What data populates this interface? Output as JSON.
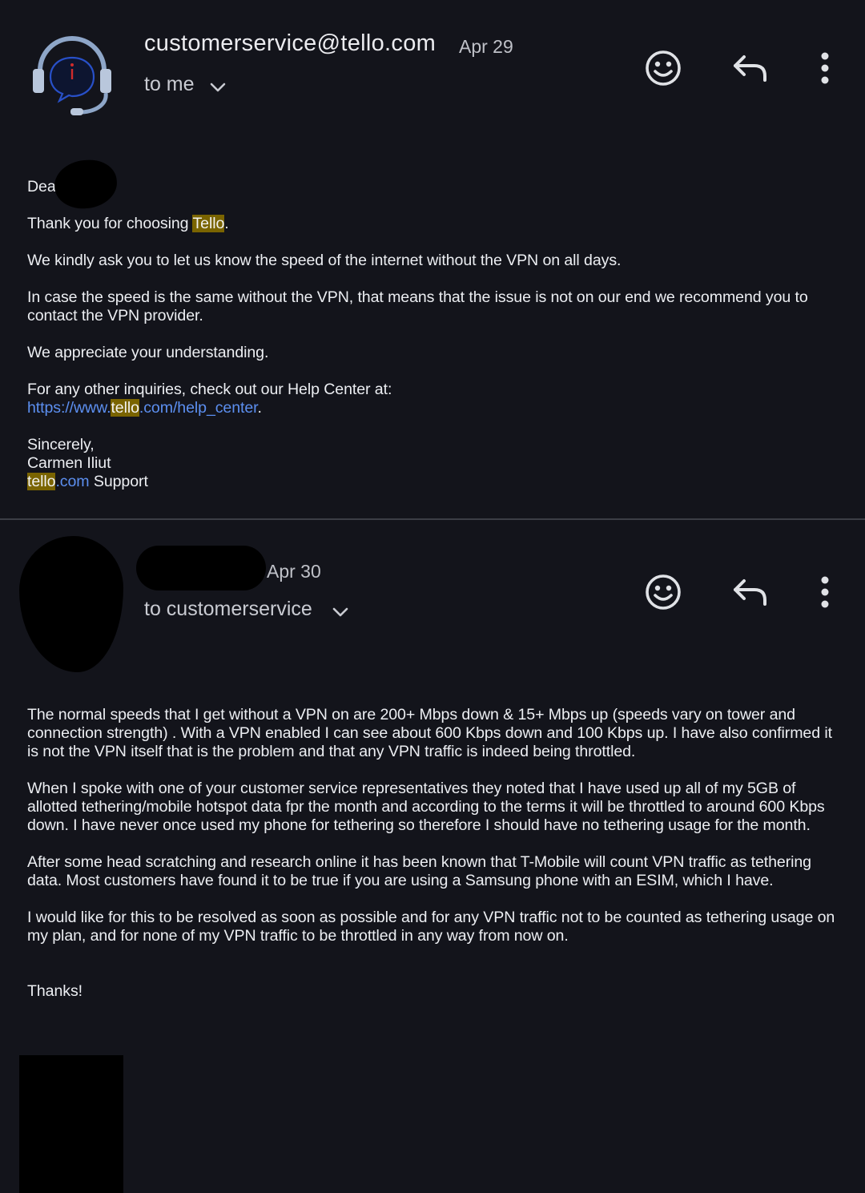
{
  "messages": [
    {
      "sender": "customerservice@tello.com",
      "date": "Apr 29",
      "recipient": "to me",
      "body": {
        "greeting": "Dear",
        "thanks_prefix": "Thank you for choosing ",
        "thanks_brand": "Tello",
        "thanks_suffix": ".",
        "p2": "We kindly ask you to let us know the speed of the internet without the VPN on all days.",
        "p3": "In case the speed is the same without the VPN, that means that the issue is not on our end we recommend you to contact the VPN provider.",
        "p4": "We appreciate your understanding.",
        "help_text": "For any other inquiries, check out our Help Center at:",
        "link_prefix": "https://www.",
        "link_brand": "tello",
        "link_suffix": ".com/help_center",
        "link_after": ".",
        "signoff": "Sincerely,",
        "signer": "Carmen Iliut",
        "sig_brand": "tello",
        "sig_domain": ".com",
        "sig_rest": " Support"
      }
    },
    {
      "date": "Apr 30",
      "recipient": "to customerservice",
      "body": {
        "p1": "The normal speeds that I get without a VPN on are 200+ Mbps down & 15+ Mbps up (speeds vary on tower and connection strength) . With a VPN enabled I can see about 600 Kbps down and 100 Kbps up. I have also confirmed it is not the VPN itself that is the problem and that any VPN traffic is indeed being throttled.",
        "p2": "When I spoke with one of your customer service representatives they noted that I have used up all of my 5GB of allotted tethering/mobile hotspot data fpr the month and according to the terms it will be throttled to around 600 Kbps down. I have never once used my phone for tethering so therefore I should have no tethering usage for the month.",
        "p3": "After some head scratching and research online it has been known that T-Mobile will count VPN traffic as tethering data. Most customers have found it to be true if you are using a Samsung phone with an ESIM, which I have.",
        "p4": "I would like for this to be resolved as soon as possible and for any VPN traffic not to be counted as tethering usage on my plan, and for none of my VPN traffic to be throttled in any way from now on.",
        "closing": "Thanks!"
      }
    }
  ],
  "icons": {
    "avatar": "headset-support-icon",
    "react": "emoji-smile-icon",
    "reply": "reply-arrow-icon",
    "more": "more-vert-icon",
    "expand": "chevron-down-icon"
  },
  "colors": {
    "background": "#13141b",
    "highlight": "#7a6400",
    "link": "#5c8ff0",
    "avatar_accent": "#8ea6c8",
    "avatar_dot": "#d12b2b"
  }
}
